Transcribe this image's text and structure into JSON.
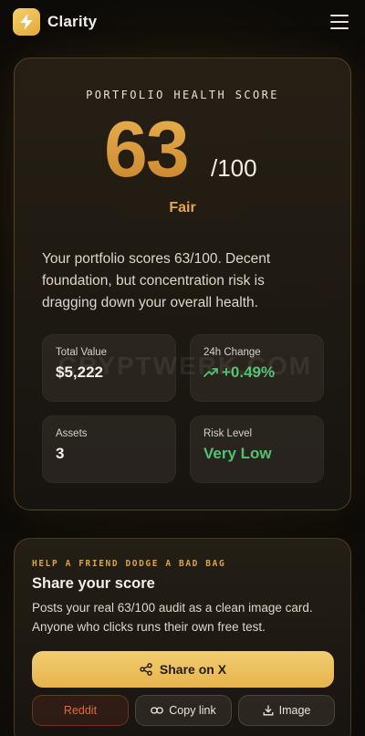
{
  "header": {
    "brand_name": "Clarity",
    "logo_icon": "lightning-bolt-icon",
    "menu_icon": "hamburger-menu-icon"
  },
  "score_card": {
    "label": "PORTFOLIO HEALTH SCORE",
    "score": "63",
    "score_max": "/100",
    "rating": "Fair",
    "description": "Your portfolio scores 63/100. Decent foundation, but concentration risk is dragging down your overall health.",
    "stats": [
      {
        "label": "Total Value",
        "value": "$5,222"
      },
      {
        "label": "24h Change",
        "value": "+0.49%",
        "icon": "trending-up-icon"
      },
      {
        "label": "Assets",
        "value": "3"
      },
      {
        "label": "Risk Level",
        "value": "Very Low"
      }
    ]
  },
  "watermark": "CRYPTWERK.COM",
  "share": {
    "eyebrow": "HELP A FRIEND DODGE A BAD BAG",
    "title": "Share your score",
    "description": "Posts your real 63/100 audit as a clean image card. Anyone who clicks runs their own free test.",
    "primary_button": "Share on X",
    "reddit_button": "Reddit",
    "copy_button": "Copy link",
    "image_button": "Image"
  },
  "colors": {
    "accent": "#e6b44b",
    "score_gold": "#d89a3a",
    "positive": "#4fc46e",
    "reddit": "#e8673f",
    "background": "#0d0b08"
  }
}
